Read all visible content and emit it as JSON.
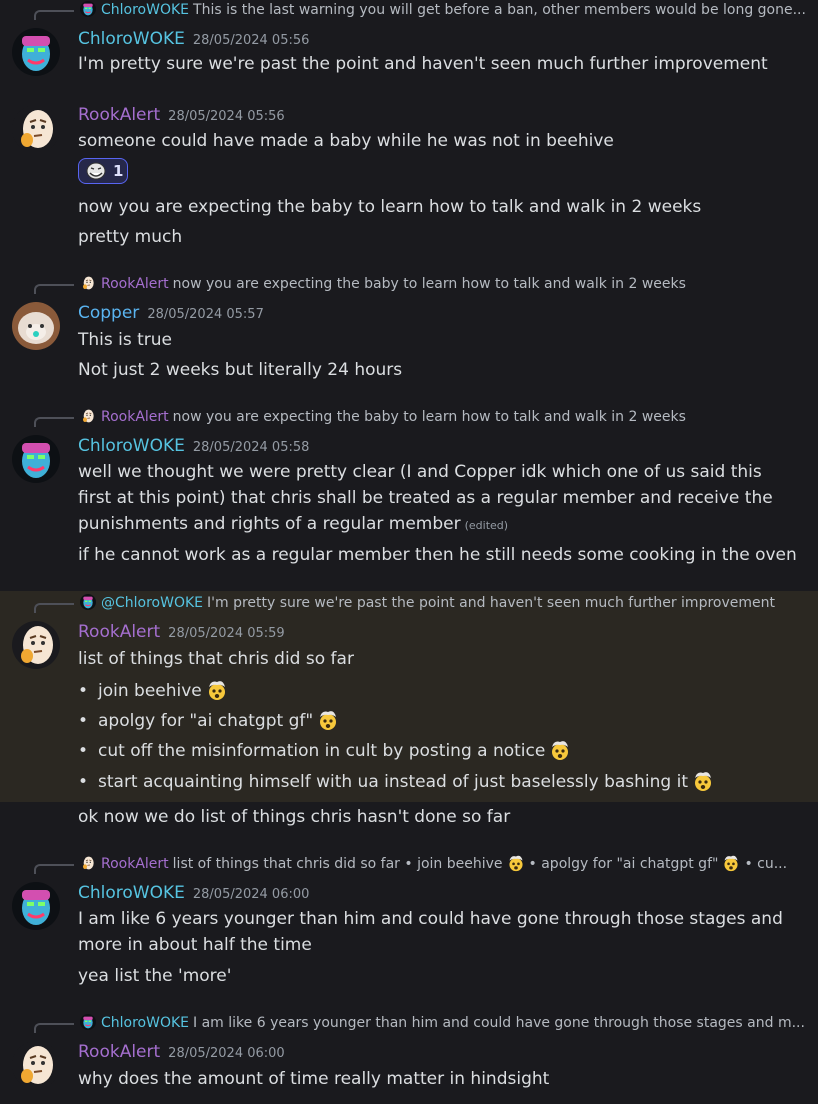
{
  "colors": {
    "background": "#1a1a1e",
    "highlight": "#2b2822",
    "chloro": "#56c3e0",
    "rook": "#a56fcf",
    "copper": "#5ab4f0",
    "text": "#dbdee1",
    "muted": "#949ba4"
  },
  "m1": {
    "reply_name": "ChloroWOKE",
    "reply_text": "This is the last warning you will get before a ban, other members would be long gone...",
    "author": "ChloroWOKE",
    "ts": "28/05/2024 05:56",
    "text": "I'm pretty sure we're past the point and haven't seen much further improvement"
  },
  "m2": {
    "author": "RookAlert",
    "ts": "28/05/2024 05:56",
    "line1": "someone could have made a baby while he was not in beehive",
    "reaction_count": "1",
    "reaction_icon": "troll-face-icon",
    "line2": "now you are expecting the baby to learn how to talk and walk in 2 weeks",
    "line3": "pretty much"
  },
  "m3": {
    "reply_name": "RookAlert",
    "reply_text": "now you are expecting the baby to learn how to talk and walk in 2 weeks",
    "author": "Copper",
    "ts": "28/05/2024 05:57",
    "line1": "This is true",
    "line2": "Not just 2 weeks but literally 24 hours"
  },
  "m4": {
    "reply_name": "RookAlert",
    "reply_text": "now you are expecting the baby to learn how to talk and walk in 2 weeks",
    "author": "ChloroWOKE",
    "ts": "28/05/2024 05:58",
    "para": "well we thought we were pretty clear (I and Copper idk which one of us said this first at this point) that chris shall be treated as a regular member and receive the punishments and rights of a regular member",
    "edited": "(edited)",
    "line2": "if he cannot work as a regular member then he still needs some cooking in the oven"
  },
  "m5": {
    "reply_name": "@ChloroWOKE",
    "reply_text": "I'm pretty sure we're past the point and haven't seen much further improvement",
    "author": "RookAlert",
    "ts": "28/05/2024 05:59",
    "intro": "list of things that chris did so far",
    "bullets": [
      "join beehive",
      "apolgy for \"ai chatgpt gf\"",
      "cut off the misinformation in cult by posting a notice",
      "start acquainting himself with ua instead of just baselessly bashing it"
    ],
    "bullet_emoji": "exploding-head-icon",
    "followup": "ok now we do list of things chris hasn't done so far"
  },
  "m6": {
    "reply_name": "RookAlert",
    "reply_a": "list of things that chris did so far • join beehive",
    "reply_b": "• apolgy for \"ai chatgpt gf\"",
    "reply_c": "• cu...",
    "author": "ChloroWOKE",
    "ts": "28/05/2024 06:00",
    "para": "I am like 6 years younger than him and could have gone through those stages and more in about half the time",
    "line2": "yea list the 'more'"
  },
  "m7": {
    "reply_name": "ChloroWOKE",
    "reply_text": "I am like 6 years younger than him and could have gone through those stages and m...",
    "author": "RookAlert",
    "ts": "28/05/2024 06:00",
    "text": "why does the amount of time really matter in hindsight"
  }
}
